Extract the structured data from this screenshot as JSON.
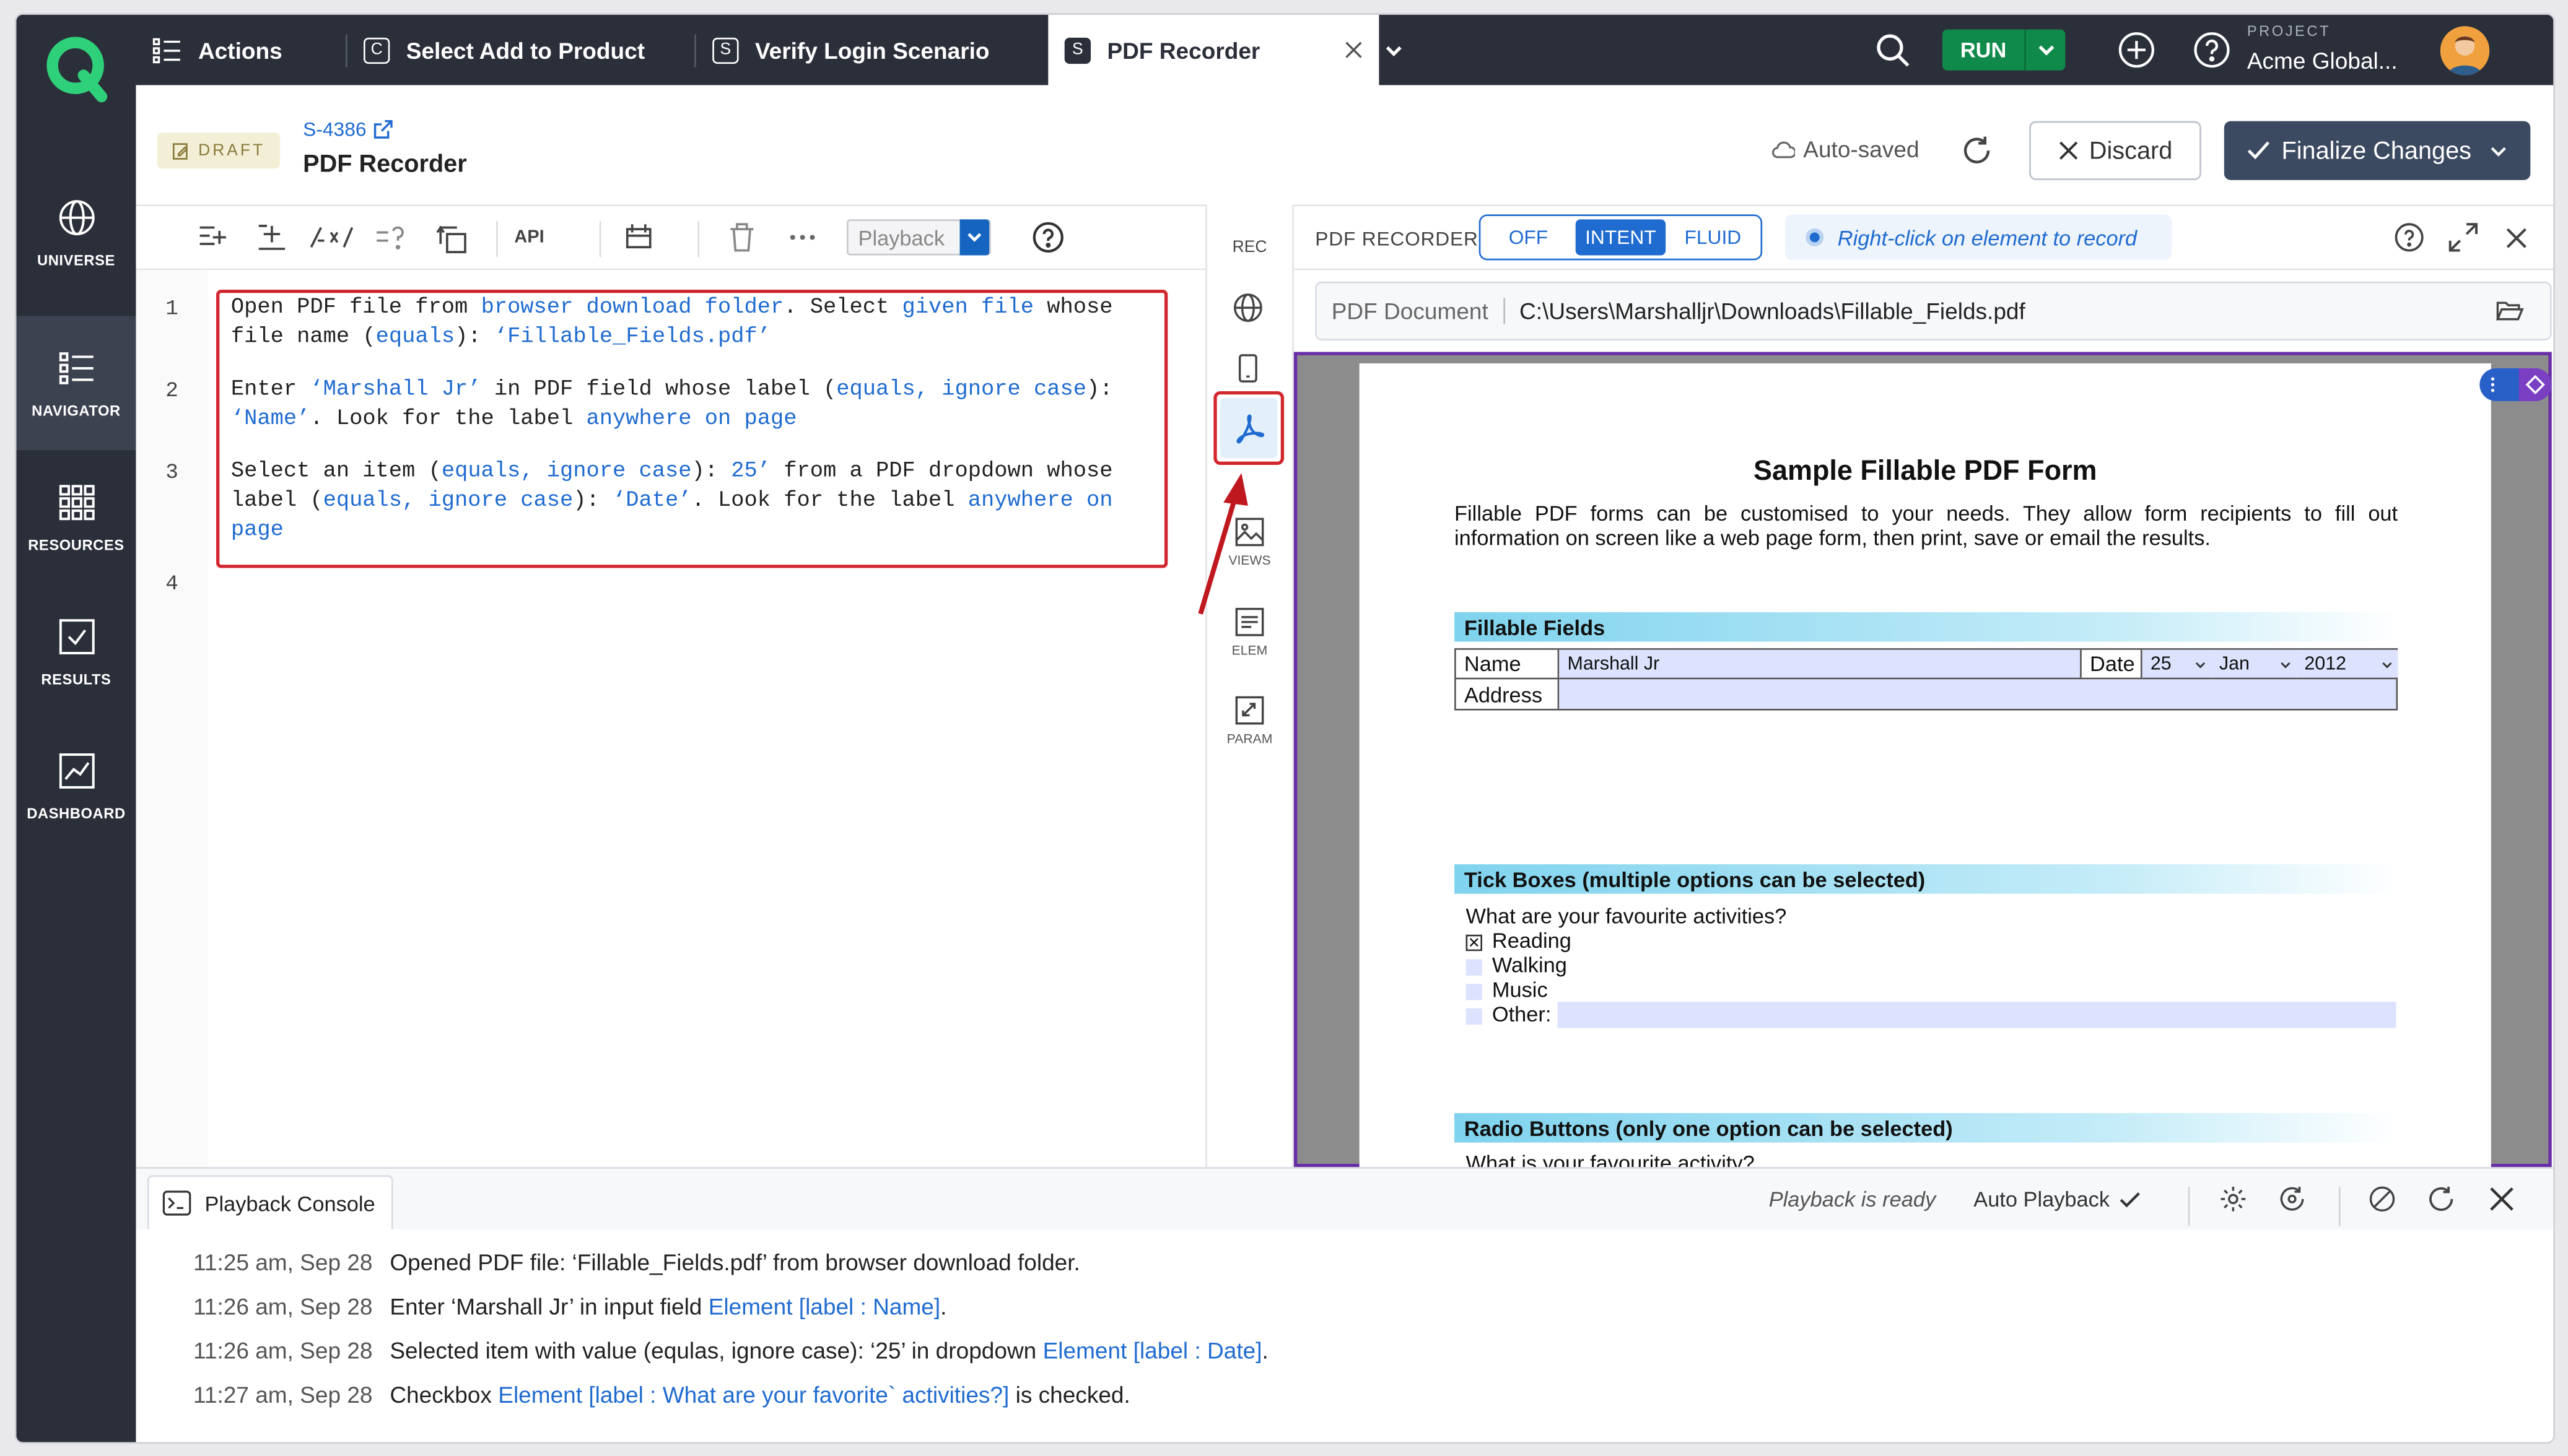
{
  "nav": {
    "items": [
      {
        "label": "UNIVERSE",
        "icon": "globe-icon"
      },
      {
        "label": "NAVIGATOR",
        "icon": "list-icon"
      },
      {
        "label": "RESOURCES",
        "icon": "grid-icon"
      },
      {
        "label": "RESULTS",
        "icon": "check-square-icon"
      },
      {
        "label": "DASHBOARD",
        "icon": "chart-icon"
      }
    ],
    "active": "NAVIGATOR"
  },
  "tabs": [
    {
      "label": "Actions",
      "badge": ""
    },
    {
      "label": "Select Add to Product",
      "badge": "C"
    },
    {
      "label": "Verify Login Scenario",
      "badge": "S"
    },
    {
      "label": "PDF Recorder",
      "badge": "S"
    }
  ],
  "topbar": {
    "run_label": "RUN",
    "project_label": "PROJECT",
    "project_name": "Acme Global..."
  },
  "header": {
    "status": "DRAFT",
    "story_id": "S-4386",
    "title": "PDF Recorder",
    "autosaved": "Auto-saved",
    "discard_label": "Discard",
    "finalize_label": "Finalize Changes"
  },
  "editor": {
    "toolbar": {
      "api_label": "API",
      "playback_placeholder": "Playback"
    },
    "line_numbers": [
      "1",
      "2",
      "3",
      "4"
    ],
    "lines": [
      [
        [
          [
            "t",
            "Open PDF file from "
          ],
          [
            "k",
            "browser download folder"
          ],
          [
            "t",
            ". Select "
          ],
          [
            "k",
            "given file"
          ],
          [
            "t",
            " whose"
          ]
        ],
        [
          [
            "t",
            "file name ("
          ],
          [
            "k",
            "equals"
          ],
          [
            "t",
            "): "
          ],
          [
            "k",
            "‘Fillable_Fields.pdf’"
          ]
        ]
      ],
      [
        [
          [
            "t",
            "Enter "
          ],
          [
            "k",
            "‘Marshall Jr’"
          ],
          [
            "t",
            " in PDF field whose label ("
          ],
          [
            "k",
            "equals, ignore case"
          ],
          [
            "t",
            "):"
          ]
        ],
        [
          [
            "k",
            "‘Name’"
          ],
          [
            "t",
            ". Look for the label "
          ],
          [
            "k",
            "anywhere on page"
          ]
        ]
      ],
      [
        [
          [
            "t",
            "Select an item ("
          ],
          [
            "k",
            "equals, ignore case"
          ],
          [
            "t",
            "): "
          ],
          [
            "k",
            "25’"
          ],
          [
            "t",
            " from a PDF dropdown whose"
          ]
        ],
        [
          [
            "t",
            "label ("
          ],
          [
            "k",
            "equals, ignore case"
          ],
          [
            "t",
            "): "
          ],
          [
            "k",
            "‘Date’"
          ],
          [
            "t",
            ". Look for the label "
          ],
          [
            "k",
            "anywhere on"
          ]
        ],
        [
          [
            "k",
            "page"
          ]
        ]
      ]
    ]
  },
  "rail": {
    "rec_label": "REC",
    "views_label": "VIEWS",
    "elem_label": "ELEM",
    "param_label": "PARAM"
  },
  "recorder": {
    "title": "PDF RECORDER",
    "modes": [
      "OFF",
      "INTENT",
      "FLUID"
    ],
    "active_mode": "INTENT",
    "hint": "Right-click on element to record",
    "doc_label": "PDF Document",
    "doc_path": "C:\\Users\\Marshalljr\\Downloads\\Fillable_Fields.pdf"
  },
  "pdf": {
    "title": "Sample Fillable PDF Form",
    "intro": "Fillable PDF forms can be customised to your needs. They allow form recipients to fill out information on screen like a web page form, then print, save or email the results.",
    "section1": "Fillable Fields",
    "name_label": "Name",
    "name_value": "Marshall Jr",
    "date_label": "Date",
    "date_day": "25",
    "date_month": "Jan",
    "date_year": "2012",
    "address_label": "Address",
    "section2": "Tick Boxes (multiple options can be selected)",
    "question": "What are your favourite activities?",
    "checkboxes": [
      {
        "label": "Reading",
        "checked": true
      },
      {
        "label": "Walking",
        "checked": false
      },
      {
        "label": "Music",
        "checked": false
      },
      {
        "label": "Other:",
        "checked": false
      }
    ],
    "section3": "Radio Buttons (only one option can be selected)",
    "radio_question": "What is your favourite activity?"
  },
  "console": {
    "tab_label": "Playback Console",
    "status": "Playback is ready",
    "auto_playback": "Auto Playback",
    "logs": [
      {
        "time": "11:25 am, Sep 28",
        "parts": [
          [
            "t",
            "Opened PDF file: ‘Fillable_Fields.pdf’ from browser download folder."
          ]
        ]
      },
      {
        "time": "11:26 am, Sep 28",
        "parts": [
          [
            "t",
            "Enter ‘Marshall Jr’ in input field "
          ],
          [
            "k",
            "Element [label : Name]"
          ],
          [
            "t",
            "."
          ]
        ]
      },
      {
        "time": "11:26 am, Sep 28",
        "parts": [
          [
            "t",
            "Selected item with value (equlas, ignore case): ‘25’ in dropdown "
          ],
          [
            "k",
            "Element [label : Date]"
          ],
          [
            "t",
            "."
          ]
        ]
      },
      {
        "time": "11:27 am, Sep 28",
        "parts": [
          [
            "t",
            "Checkbox "
          ],
          [
            "k",
            "Element [label : What are your favorite` activities?]"
          ],
          [
            "t",
            " is checked."
          ]
        ]
      }
    ]
  },
  "colors": {
    "nav_bg": "#2b2f3a",
    "accent": "#1f6bd0",
    "run_green": "#108a4a",
    "highlight_red": "#d2262d",
    "finalize_bg": "#3c4a61"
  }
}
